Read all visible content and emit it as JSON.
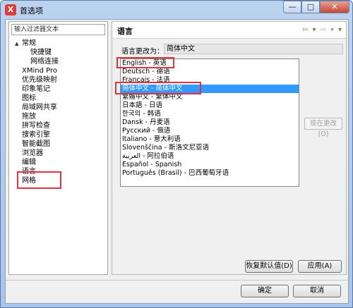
{
  "window": {
    "title": "首选项",
    "app_icon_letter": "X",
    "caption": {
      "minimize": "—",
      "maximize": "□",
      "close": "✕"
    }
  },
  "sidebar": {
    "filter_placeholder": "输入过滤器文本",
    "items": [
      {
        "label": "常规",
        "indent": 1,
        "twisty": "▲"
      },
      {
        "label": "快捷键",
        "indent": 2
      },
      {
        "label": "网络连接",
        "indent": 2
      },
      {
        "label": "XMind Pro",
        "indent": 0
      },
      {
        "label": "优先级映射",
        "indent": 0
      },
      {
        "label": "印象笔记",
        "indent": 0
      },
      {
        "label": "图标",
        "indent": 0
      },
      {
        "label": "局域网共享",
        "indent": 0
      },
      {
        "label": "拖放",
        "indent": 0
      },
      {
        "label": "拼写检查",
        "indent": 0
      },
      {
        "label": "搜索引擎",
        "indent": 0
      },
      {
        "label": "智能截图",
        "indent": 0
      },
      {
        "label": "浏览器",
        "indent": 0
      },
      {
        "label": "编辑",
        "indent": 0
      },
      {
        "label": "语言",
        "indent": 0
      },
      {
        "label": "网格",
        "indent": 0
      }
    ]
  },
  "page": {
    "title": "语言",
    "nav": {
      "back": "⇦",
      "back_menu": "▾",
      "forward": "⇨",
      "forward_menu": "▾",
      "view_menu": "▾"
    },
    "change_to_label": "语言更改为：",
    "change_to_value": "简体中文",
    "languages": [
      "English - 英语",
      "Deutsch - 德语",
      "Français - 法语",
      "简体中文 - 简体中文",
      "繁體中文 - 繁体中文",
      "日本語 - 日语",
      "한국의 - 韩语",
      "Dansk - 丹麦语",
      "Русский - 俄语",
      "Italiano - 意大利语",
      "Slovenščina - 斯洛文尼亚语",
      "العربية - 阿拉伯语",
      "Español - Spanish",
      "Português (Brasil) - 巴西葡萄牙语"
    ],
    "selected_language": "简体中文 - 简体中文",
    "apply_now_label": "现在更改(O)",
    "restore_defaults_label": "恢复默认值(D)",
    "apply_label": "应用(A)"
  },
  "footer": {
    "ok_label": "确定",
    "cancel_label": "取消"
  },
  "colors": {
    "highlight_box": "#e0343d",
    "selection": "#3399ff"
  }
}
